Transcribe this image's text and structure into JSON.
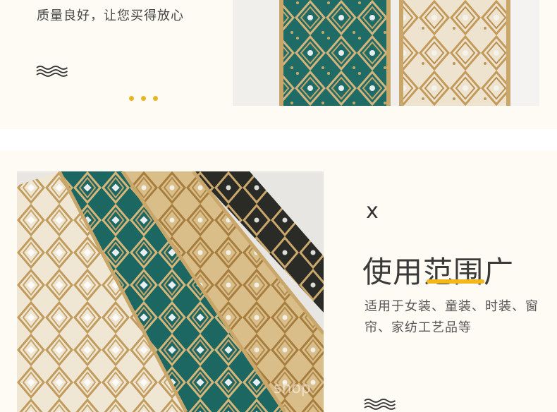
{
  "top_section": {
    "text": "质量良好，让您买得放心"
  },
  "bottom_section": {
    "mark": "x",
    "heading": "使用范围广",
    "description": "适用于女装、童装、时装、窗帘、家纺工艺品等"
  },
  "watermark": "shop",
  "colors": {
    "accent_dot": "#e7b625",
    "accent_underline": "#f2b71d",
    "band_bg": "#fdfbf3",
    "teal": "#1f6b66",
    "gold": "#c9a66a"
  },
  "icons": {
    "top_wave": "wave-icon",
    "bottom_wave": "wave-icon",
    "dots": "ellipsis-dots-icon"
  }
}
